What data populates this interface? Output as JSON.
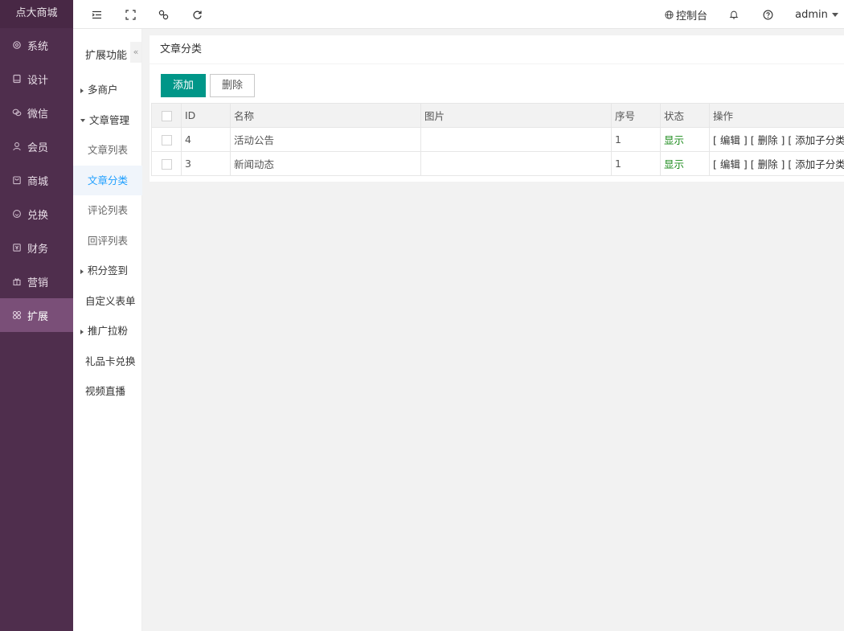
{
  "app": {
    "logo": "点大商城"
  },
  "sidebar": {
    "items": [
      {
        "label": "系统",
        "icon": "gear-icon",
        "active": false
      },
      {
        "label": "设计",
        "icon": "monitor-icon",
        "active": false
      },
      {
        "label": "微信",
        "icon": "wechat-icon",
        "active": false
      },
      {
        "label": "会员",
        "icon": "user-icon",
        "active": false
      },
      {
        "label": "商城",
        "icon": "shopping-bag-icon",
        "active": false
      },
      {
        "label": "兑换",
        "icon": "exchange-icon",
        "active": false
      },
      {
        "label": "财务",
        "icon": "finance-icon",
        "active": false
      },
      {
        "label": "营销",
        "icon": "gift-icon",
        "active": false
      },
      {
        "label": "扩展",
        "icon": "grid-icon",
        "active": true
      }
    ]
  },
  "topbar": {
    "menu_icon": "menu-indent-icon",
    "fullscreen_icon": "fullscreen-icon",
    "link_icon": "link-icon",
    "refresh_icon": "refresh-icon",
    "console_label": "控制台",
    "user_label": "admin"
  },
  "subnav": {
    "title": "扩展功能",
    "collapse": "«",
    "items": [
      {
        "label": "多商户",
        "type": "group",
        "expanded": false
      },
      {
        "label": "文章管理",
        "type": "group",
        "expanded": true
      },
      {
        "label": "文章列表",
        "type": "child",
        "active": false
      },
      {
        "label": "文章分类",
        "type": "child",
        "active": true
      },
      {
        "label": "评论列表",
        "type": "child",
        "active": false
      },
      {
        "label": "回评列表",
        "type": "child",
        "active": false
      },
      {
        "label": "积分签到",
        "type": "group",
        "expanded": false
      },
      {
        "label": "自定义表单",
        "type": "plain"
      },
      {
        "label": "推广拉粉",
        "type": "group",
        "expanded": false
      },
      {
        "label": "礼品卡兑换",
        "type": "plain"
      },
      {
        "label": "视频直播",
        "type": "plain"
      }
    ]
  },
  "main": {
    "title": "文章分类",
    "add_button": "添加",
    "delete_button": "删除",
    "table": {
      "headers": [
        "ID",
        "名称",
        "图片",
        "序号",
        "状态",
        "操作"
      ],
      "rows": [
        {
          "id": "4",
          "name": "活动公告",
          "image": "",
          "sort": "1",
          "status": "显示"
        },
        {
          "id": "3",
          "name": "新闻动态",
          "image": "",
          "sort": "1",
          "status": "显示"
        }
      ],
      "ops": {
        "edit": "编辑",
        "delete": "删除",
        "add_child": "添加子分类"
      }
    }
  },
  "colors": {
    "sidebar_bg": "#4f2e4d",
    "sidebar_active": "#7a4f78",
    "primary_button": "#009688",
    "status_green": "#1a8a1a",
    "subnav_active": "#1e9fff"
  }
}
